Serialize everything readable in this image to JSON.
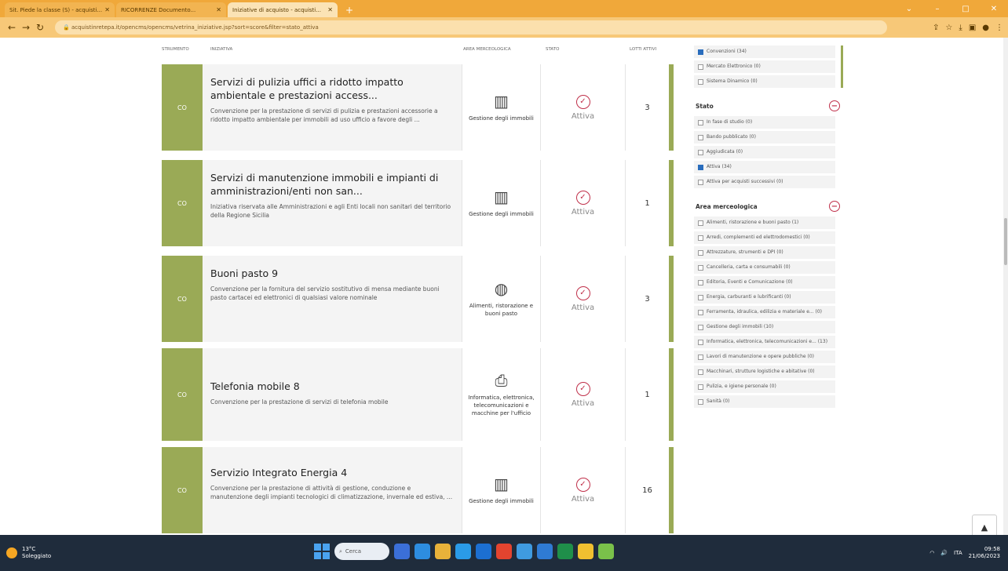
{
  "browser": {
    "tabs": [
      {
        "label": "Sit. Piede la classe (S) - acquisti...",
        "active": false
      },
      {
        "label": "RICORRENZE Documento...",
        "active": false
      },
      {
        "label": "Iniziative di acquisto - acquisti...",
        "active": true
      }
    ],
    "new_tab": "+",
    "url": "acquistinretepa.it/opencms/opencms/vetrina_iniziative.jsp?sort=score&filter=stato_attiva",
    "win_controls": [
      "⌄",
      "–",
      "□",
      "✕"
    ]
  },
  "columns": {
    "strumento": "STRUMENTO",
    "iniziativa": "INIZIATIVA",
    "area": "AREA MERCEOLOGICA",
    "stato": "STATO",
    "lotti": "LOTTI ATTIVI"
  },
  "cards": [
    {
      "tag": "CO",
      "title": "Servizi di pulizia uffici a ridotto impatto ambientale e prestazioni access...",
      "desc": "Convenzione per la prestazione di servizi di pulizia e prestazioni accessorie a ridotto impatto ambientale per immobili ad uso ufficio a favore degli ...",
      "area_icon": "building-icon",
      "area": "Gestione degli immobili",
      "state": "Attiva",
      "lots": "3"
    },
    {
      "tag": "CO",
      "title": "Servizi di manutenzione immobili e impianti di amministrazioni/enti non san...",
      "desc": "Iniziativa riservata alle Amministrazioni e agli Enti locali non sanitari del territorio della Regione Sicilia",
      "area_icon": "building-icon",
      "area": "Gestione degli immobili",
      "state": "Attiva",
      "lots": "1"
    },
    {
      "tag": "CO",
      "title": "Buoni pasto 9",
      "desc": "Convenzione per la fornitura del servizio sostitutivo di mensa mediante buoni pasto cartacei ed elettronici di qualsiasi valore nominale",
      "area_icon": "food-icon",
      "area": "Alimenti, ristorazione e buoni pasto",
      "state": "Attiva",
      "lots": "3"
    },
    {
      "tag": "CO",
      "title": "Telefonia mobile 8",
      "desc": "Convenzione per la prestazione di servizi di telefonia mobile",
      "area_icon": "printer-icon",
      "area": "Informatica, elettronica, telecomunicazioni e macchine per l'ufficio",
      "state": "Attiva",
      "lots": "1"
    },
    {
      "tag": "CO",
      "title": "Servizio Integrato Energia 4",
      "desc": "Convenzione per la prestazione di attività di gestione, conduzione e manutenzione degli impianti tecnologici di climatizzazione, invernale ed estiva, ...",
      "area_icon": "building-icon",
      "area": "Gestione degli immobili",
      "state": "Attiva",
      "lots": "16"
    }
  ],
  "filters": {
    "strumento_items": [
      {
        "label": "Convenzioni (34)",
        "checked": true
      },
      {
        "label": "Mercato Elettronico (0)",
        "checked": false
      },
      {
        "label": "Sistema Dinamico (0)",
        "checked": false
      }
    ],
    "stato_title": "Stato",
    "stato_items": [
      {
        "label": "In fase di studio (0)",
        "checked": false
      },
      {
        "label": "Bando pubblicato (0)",
        "checked": false
      },
      {
        "label": "Aggiudicata (0)",
        "checked": false
      },
      {
        "label": "Attiva (34)",
        "checked": true
      },
      {
        "label": "Attiva per acquisti successivi (0)",
        "checked": false
      }
    ],
    "area_title": "Area merceologica",
    "area_items": [
      {
        "label": "Alimenti, ristorazione e buoni pasto (1)",
        "checked": false
      },
      {
        "label": "Arredi, complementi ed elettrodomestici (0)",
        "checked": false
      },
      {
        "label": "Attrezzature, strumenti e DPI (0)",
        "checked": false
      },
      {
        "label": "Cancelleria, carta e consumabili (0)",
        "checked": false
      },
      {
        "label": "Editoria, Eventi e Comunicazione (0)",
        "checked": false
      },
      {
        "label": "Energia, carburanti e lubrificanti (0)",
        "checked": false
      },
      {
        "label": "Ferramenta, idraulica, edilizia e materiale e... (0)",
        "checked": false
      },
      {
        "label": "Gestione degli immobili (10)",
        "checked": false
      },
      {
        "label": "Informatica, elettronica, telecomunicazioni e... (13)",
        "checked": false
      },
      {
        "label": "Lavori di manutenzione e opere pubbliche (0)",
        "checked": false
      },
      {
        "label": "Macchinari, strutture logistiche e abitative (0)",
        "checked": false
      },
      {
        "label": "Pulizia, e igiene personale (0)",
        "checked": false
      },
      {
        "label": "Sanità (0)",
        "checked": false
      }
    ],
    "collapse_symbol": "−"
  },
  "back_to_top": "▲",
  "taskbar": {
    "weather_temp": "13°C",
    "weather_desc": "Soleggiato",
    "search_placeholder": "Cerca",
    "time": "09:58",
    "date": "21/06/2023",
    "lang": "ITA"
  },
  "colors": {
    "accent": "#9aaa56",
    "state_red": "#c0304a",
    "browser_orange": "#f0a83a"
  }
}
